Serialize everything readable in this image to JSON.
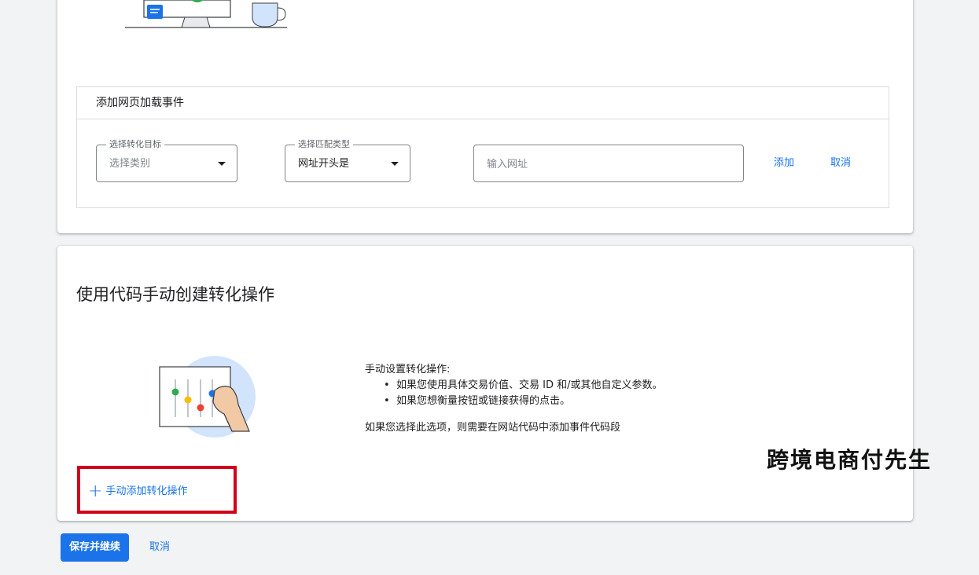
{
  "page_load_event": {
    "title": "添加网页加载事件",
    "goal_field": {
      "label": "选择转化目标",
      "placeholder": "选择类别"
    },
    "match_field": {
      "label": "选择匹配类型",
      "value": "网址开头是"
    },
    "url_field": {
      "placeholder": "输入网址"
    },
    "add_label": "添加",
    "cancel_label": "取消"
  },
  "manual_section": {
    "title": "使用代码手动创建转化操作",
    "intro": "手动设置转化操作:",
    "bullets": [
      "如果您使用具体交易价值、交易 ID 和/或其他自定义参数。",
      "如果您想衡量按钮或链接获得的点击。"
    ],
    "note": "如果您选择此选项，则需要在网站代码中添加事件代码段",
    "add_manual_label": "手动添加转化操作"
  },
  "footer": {
    "save_label": "保存并继续",
    "cancel_label": "取消"
  },
  "watermark": "跨境电商付先生",
  "colors": {
    "accent": "#1a73e8",
    "highlight_border": "#d0021b",
    "background": "#f1f3f4"
  }
}
